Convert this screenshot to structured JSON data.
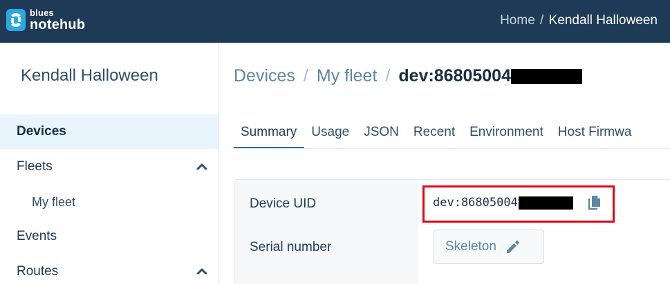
{
  "header": {
    "logo_small": "blues",
    "logo_big": "notehub",
    "breadcrumb_home": "Home",
    "breadcrumb_sep": "/",
    "breadcrumb_project": "Kendall Halloween"
  },
  "sidebar": {
    "project_title": "Kendall Halloween",
    "items": [
      {
        "label": "Devices",
        "active": true
      },
      {
        "label": "Fleets",
        "expandable": true,
        "expanded": true,
        "icon": "chevron-up-icon"
      },
      {
        "label": "My fleet",
        "sub": true
      },
      {
        "label": "Events"
      },
      {
        "label": "Routes",
        "expandable": true,
        "expanded": true,
        "icon": "chevron-up-icon"
      }
    ]
  },
  "main": {
    "breadcrumb": {
      "devices": "Devices",
      "sep": "/",
      "fleet": "My fleet",
      "device_prefix": "dev:86805004"
    },
    "tabs": [
      "Summary",
      "Usage",
      "JSON",
      "Recent",
      "Environment",
      "Host Firmwa"
    ],
    "active_tab": "Summary",
    "details": {
      "device_uid_label": "Device UID",
      "device_uid_prefix": "dev:86805004",
      "serial_number_label": "Serial number",
      "serial_number_value": "Skeleton"
    }
  },
  "colors": {
    "topbar": "#1e3a56",
    "active_nav_bg": "#e8f5fc",
    "highlight_box": "#e30613",
    "link": "#5b86a8"
  }
}
